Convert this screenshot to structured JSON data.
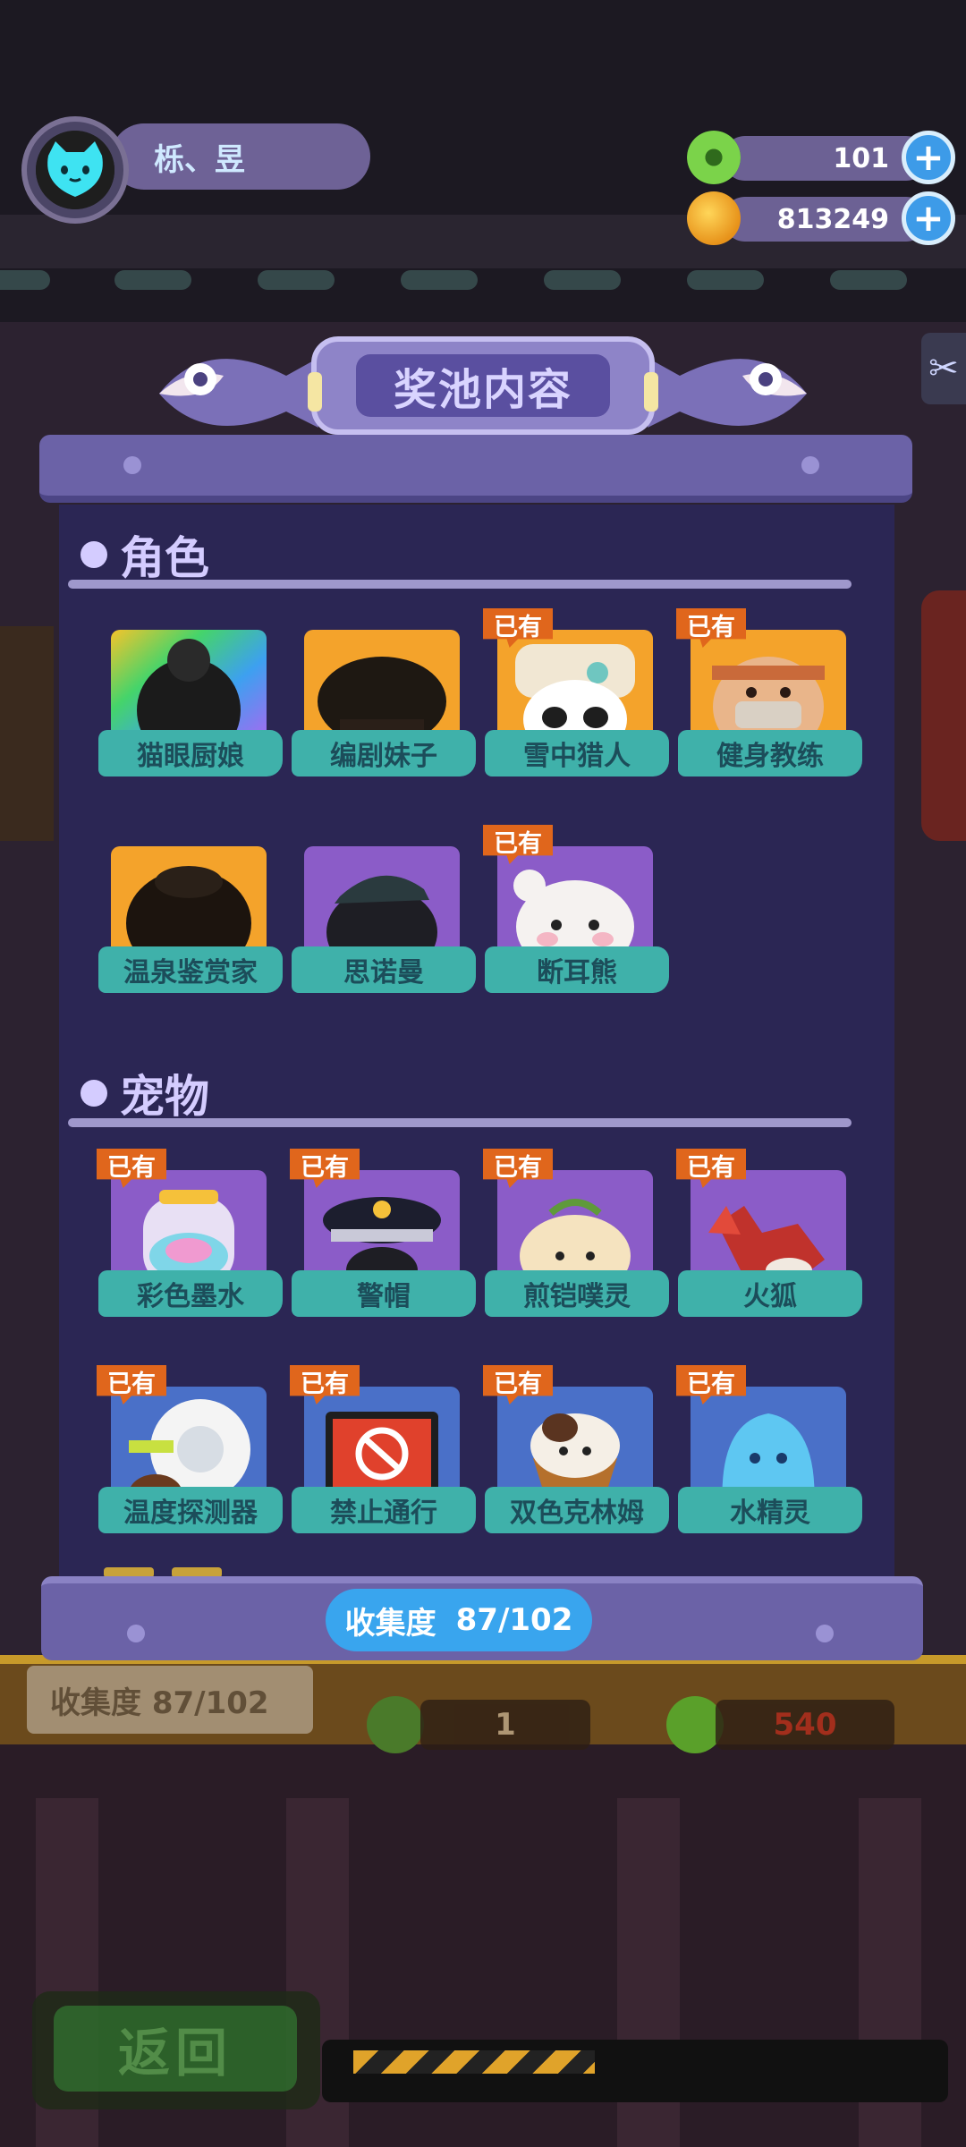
{
  "header": {
    "username": "栎、昱",
    "currency": [
      {
        "name": "green-donut",
        "icon": "green-donut-icon",
        "amount": "101",
        "color": "#6ed040"
      },
      {
        "name": "gold-coin",
        "icon": "gold-planet-coin-icon",
        "amount": "813249",
        "color": "#f3b220"
      }
    ],
    "plus_label": "+"
  },
  "modal": {
    "title": "奖池内容",
    "sections": [
      {
        "title": "角色",
        "items": [
          {
            "name": "猫眼厨娘",
            "owned": false,
            "art_bg": "rainbow"
          },
          {
            "name": "编剧妹子",
            "owned": false,
            "art_bg": "#f4a32b"
          },
          {
            "name": "雪中猎人",
            "owned": true,
            "art_bg": "#f4a32b"
          },
          {
            "name": "健身教练",
            "owned": true,
            "art_bg": "#f4a32b"
          },
          {
            "name": "温泉鉴赏家",
            "owned": false,
            "art_bg": "#f4a32b"
          },
          {
            "name": "思诺曼",
            "owned": false,
            "art_bg": "#8b5cc8"
          },
          {
            "name": "断耳熊",
            "owned": true,
            "art_bg": "#8b5cc8"
          }
        ]
      },
      {
        "title": "宠物",
        "items": [
          {
            "name": "彩色墨水",
            "owned": true,
            "art_bg": "#8b5cc8"
          },
          {
            "name": "警帽",
            "owned": true,
            "art_bg": "#8b5cc8"
          },
          {
            "name": "煎铠噗灵",
            "owned": true,
            "art_bg": "#8b5cc8"
          },
          {
            "name": "火狐",
            "owned": true,
            "art_bg": "#8b5cc8"
          },
          {
            "name": "温度探测器",
            "owned": true,
            "art_bg": "#4a70c8"
          },
          {
            "name": "禁止通行",
            "owned": true,
            "art_bg": "#4a70c8"
          },
          {
            "name": "双色克林姆",
            "owned": true,
            "art_bg": "#4a70c8"
          },
          {
            "name": "水精灵",
            "owned": true,
            "art_bg": "#4a70c8"
          }
        ]
      }
    ],
    "owned_badge": "已有",
    "collection": {
      "label": "收集度",
      "value": "87/102"
    }
  },
  "background": {
    "collection_label": "收集度   87/102",
    "price_1": "1",
    "price_2": "540"
  },
  "footer": {
    "back_label": "返回"
  }
}
